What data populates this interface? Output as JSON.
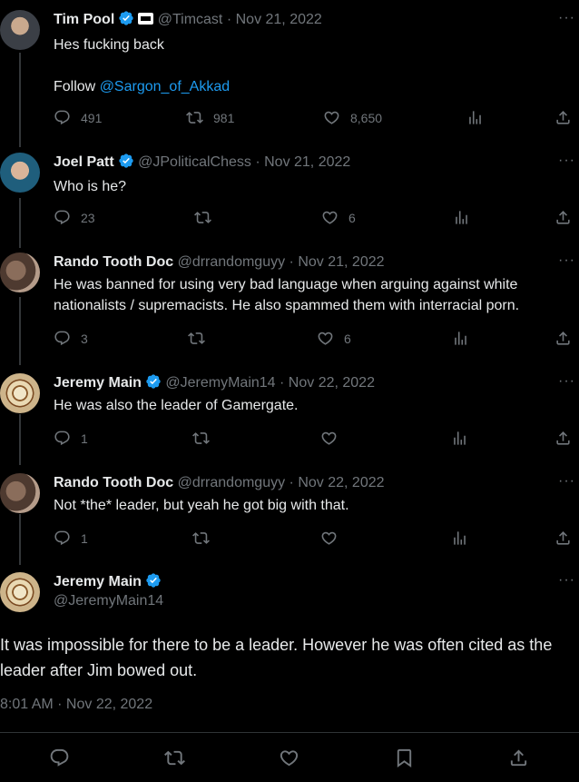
{
  "tweets": [
    {
      "name": "Tim Pool",
      "handle": "@Timcast",
      "date": "Nov 21, 2022",
      "text_line1": "Hes fucking back",
      "text_line2_prefix": "Follow ",
      "text_line2_mention": "@Sargon_of_Akkad",
      "replies": "491",
      "retweets": "981",
      "likes": "8,650"
    },
    {
      "name": "Joel Patt",
      "handle": "@JPoliticalChess",
      "date": "Nov 21, 2022",
      "text": "Who is he?",
      "replies": "23",
      "retweets": "",
      "likes": "6"
    },
    {
      "name": "Rando Tooth Doc",
      "handle": "@drrandomguyy",
      "date": "Nov 21, 2022",
      "text": "He was banned for using very bad language when arguing against white nationalists / supremacists.  He also spammed them with interracial porn.",
      "replies": "3",
      "retweets": "",
      "likes": "6"
    },
    {
      "name": "Jeremy Main",
      "handle": "@JeremyMain14",
      "date": "Nov 22, 2022",
      "text": "He was also the leader of Gamergate.",
      "replies": "1",
      "retweets": "",
      "likes": ""
    },
    {
      "name": "Rando Tooth Doc",
      "handle": "@drrandomguyy",
      "date": "Nov 22, 2022",
      "text": "Not *the* leader, but yeah he got big with that.",
      "replies": "1",
      "retweets": "",
      "likes": ""
    }
  ],
  "focus": {
    "name": "Jeremy Main",
    "handle": "@JeremyMain14",
    "text": "It was impossible for there to be a leader. However he was often cited as the leader after Jim bowed out.",
    "timestamp": "8:01 AM · Nov 22, 2022"
  },
  "separator": "·",
  "more_glyph": "···",
  "colors": {
    "background": "#000000",
    "text": "#e7e9ea",
    "secondary": "#71767b",
    "link": "#1d9bf0",
    "verified": "#1d9bf0"
  }
}
